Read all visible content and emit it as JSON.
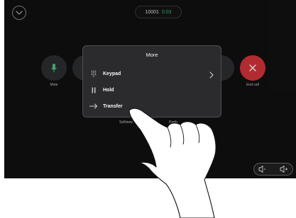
{
  "header": {
    "call_number": "10001",
    "call_time": "0:03"
  },
  "controls": {
    "mute_label": "Mute",
    "stop_video_label": "Sto",
    "end_call_label": "End call",
    "right_partial_label": "p"
  },
  "below_menu": {
    "selfview_label": "Selfview",
    "participants_label": "Partic"
  },
  "more_menu": {
    "title": "More",
    "items": [
      {
        "label": "Keypad",
        "icon": "keypad-icon",
        "has_chevron": true
      },
      {
        "label": "Hold",
        "icon": "hold-icon",
        "has_chevron": false
      },
      {
        "label": "Transfer",
        "icon": "transfer-arrow-icon",
        "has_chevron": false
      }
    ]
  },
  "colors": {
    "screen_bg": "#111112",
    "end_call": "#d8353b",
    "timer": "#3fbf78",
    "mute_icon": "#58c58c"
  }
}
